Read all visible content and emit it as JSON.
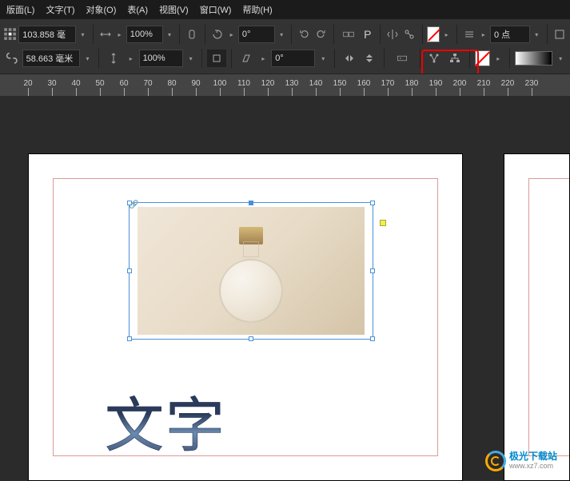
{
  "menu": {
    "layout": "版面(L)",
    "text": "文字(T)",
    "object": "对象(O)",
    "table": "表(A)",
    "view": "视图(V)",
    "window": "窗口(W)",
    "help": "帮助(H)"
  },
  "toolbar": {
    "x_value": "103.858 毫",
    "y_value": "58.663 毫米",
    "scale_w": "100%",
    "scale_h": "100%",
    "rotate": "0°",
    "shear": "0°",
    "p_label": "P",
    "stroke_pt": "0 点"
  },
  "ruler": {
    "marks": [
      "20",
      "30",
      "40",
      "50",
      "60",
      "70",
      "80",
      "90",
      "100",
      "110",
      "120",
      "130",
      "140",
      "150",
      "160",
      "170",
      "180",
      "190",
      "200",
      "210",
      "220",
      "230"
    ]
  },
  "canvas": {
    "text_block": "文字"
  },
  "watermark": {
    "name": "极光下载站",
    "url": "www.xz7.com"
  }
}
